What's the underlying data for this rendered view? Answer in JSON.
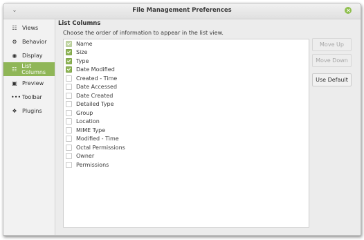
{
  "window": {
    "title": "File Management Preferences"
  },
  "sidebar": {
    "items": [
      {
        "label": "Views",
        "icon": "grid-icon"
      },
      {
        "label": "Behavior",
        "icon": "gear-icon"
      },
      {
        "label": "Display",
        "icon": "eye-icon"
      },
      {
        "label": "List Columns",
        "icon": "list-columns-icon",
        "active": true
      },
      {
        "label": "Preview",
        "icon": "preview-icon"
      },
      {
        "label": "Toolbar",
        "icon": "toolbar-icon"
      },
      {
        "label": "Plugins",
        "icon": "puzzle-icon"
      }
    ]
  },
  "content": {
    "title": "List Columns",
    "description": "Choose the order of information to appear in the list view."
  },
  "columns": [
    {
      "label": "Name",
      "checked": true,
      "locked": true
    },
    {
      "label": "Size",
      "checked": true
    },
    {
      "label": "Type",
      "checked": true
    },
    {
      "label": "Date Modified",
      "checked": true
    },
    {
      "label": "Created - Time",
      "checked": false
    },
    {
      "label": "Date Accessed",
      "checked": false
    },
    {
      "label": "Date Created",
      "checked": false
    },
    {
      "label": "Detailed Type",
      "checked": false
    },
    {
      "label": "Group",
      "checked": false
    },
    {
      "label": "Location",
      "checked": false
    },
    {
      "label": "MIME Type",
      "checked": false
    },
    {
      "label": "Modified - Time",
      "checked": false
    },
    {
      "label": "Octal Permissions",
      "checked": false
    },
    {
      "label": "Owner",
      "checked": false
    },
    {
      "label": "Permissions",
      "checked": false
    }
  ],
  "buttons": {
    "move_up": "Move Up",
    "move_down": "Move Down",
    "use_default": "Use Default"
  },
  "colors": {
    "accent": "#8fb657",
    "close": "#8fbf4e"
  }
}
